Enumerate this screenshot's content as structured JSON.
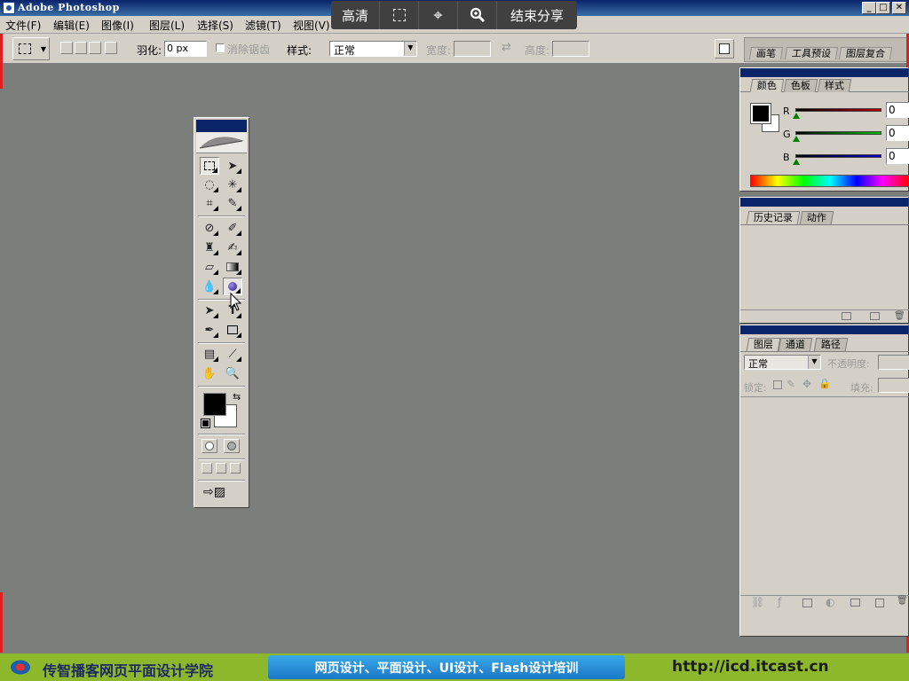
{
  "app": {
    "title": "Adobe Photoshop"
  },
  "window_buttons": {
    "minimize": "_",
    "maximize": "□",
    "close": "✕"
  },
  "menu": [
    "文件(F)",
    "编辑(E)",
    "图像(I)",
    "图层(L)",
    "选择(S)",
    "滤镜(T)",
    "视图(V)"
  ],
  "share_toolbar": {
    "quality": "高清",
    "end_share": "结束分享"
  },
  "options": {
    "feather_label": "羽化:",
    "feather_value": "0 px",
    "antialias_label": "消除锯齿",
    "style_label": "样式:",
    "style_value": "正常",
    "width_label": "宽度:",
    "height_label": "高度:"
  },
  "well_tabs": [
    "画笔",
    "工具预设",
    "图层复合"
  ],
  "color_panel": {
    "tabs": [
      "颜色",
      "色板",
      "样式"
    ],
    "channels": [
      {
        "label": "R",
        "value": "0",
        "color": "#c00000"
      },
      {
        "label": "G",
        "value": "0",
        "color": "#00a000"
      },
      {
        "label": "B",
        "value": "0",
        "color": "#0000c0"
      }
    ]
  },
  "history_panel": {
    "tabs": [
      "历史记录",
      "动作"
    ]
  },
  "layers_panel": {
    "tabs": [
      "图层",
      "通道",
      "路径"
    ],
    "blend_mode": "正常",
    "opacity_label": "不透明度:",
    "lock_label": "锁定:",
    "fill_label": "填充:"
  },
  "footer": {
    "school": "传智播客网页平面设计学院",
    "courses": "网页设计、平面设计、UI设计、Flash设计培训",
    "url": "http://icd.itcast.cn"
  },
  "colors": {
    "canvas_bg": "#7b7e7b",
    "footer_green": "#8db82b",
    "title_blue": "#0a246a"
  }
}
